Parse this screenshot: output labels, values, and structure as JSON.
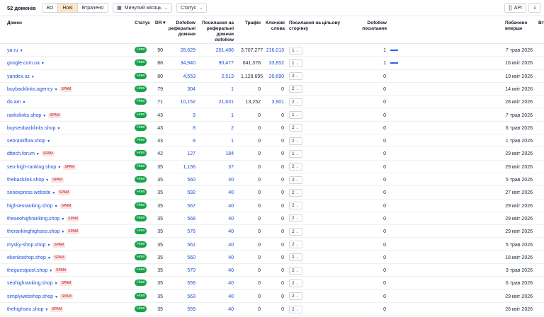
{
  "toolbar": {
    "count": "52 доменів",
    "tabs": [
      "Всі",
      "Нові",
      "Втрачено"
    ],
    "period": "Минулий місяць",
    "status_filter": "Статус",
    "api": "API"
  },
  "columns": {
    "domain": "Домен",
    "status": "Статус",
    "dr": "DR",
    "dofollow_ref": "Dofollow реферальні домени",
    "ref_domains": "Посилання на реферальні домени dofollow",
    "traffic": "Трафік",
    "keywords": "Ключові слова",
    "links_to_target": "Посилання на цільову сторінку",
    "dofollow_links": "Dofollow посилання",
    "first_seen": "Побачено вперше",
    "cut": "Вт"
  },
  "rows": [
    {
      "domain": "ya.ru",
      "spam": "",
      "status": "Нові",
      "dr": "90",
      "dofollow_ref": "28,629",
      "ref_domains": "201,486",
      "traffic": "3,707,277",
      "keywords": "216,013",
      "links": "1",
      "dofollow": "1",
      "bar": true,
      "first_seen": "7 трав 2026"
    },
    {
      "domain": "google.com.ua",
      "spam": "",
      "status": "Нові",
      "dr": "88",
      "dofollow_ref": "34,940",
      "ref_domains": "90,477",
      "traffic": "641,378",
      "keywords": "33,852",
      "links": "1",
      "dofollow": "1",
      "bar": true,
      "first_seen": "16 квіт 2026"
    },
    {
      "domain": "yandex.uz",
      "spam": "",
      "status": "Нові",
      "dr": "80",
      "dofollow_ref": "4,553",
      "ref_domains": "2,513",
      "traffic": "1,128,695",
      "keywords": "20,690",
      "links": "2",
      "dofollow": "0",
      "bar": false,
      "first_seen": "19 квіт 2026"
    },
    {
      "domain": "buybacklinks.agency",
      "spam": "SPAM",
      "status": "Нові",
      "dr": "79",
      "dofollow_ref": "304",
      "ref_domains": "1",
      "traffic": "0",
      "keywords": "0",
      "links": "2",
      "dofollow": "0",
      "bar": false,
      "first_seen": "14 квіт 2026"
    },
    {
      "domain": "do.am",
      "spam": "",
      "status": "Нові",
      "dr": "71",
      "dofollow_ref": "10,152",
      "ref_domains": "21,631",
      "traffic": "13,252",
      "keywords": "3,901",
      "links": "2",
      "dofollow": "0",
      "bar": false,
      "first_seen": "28 квіт 2026"
    },
    {
      "domain": "rankxlinks.shop",
      "spam": "SPAM",
      "status": "Нові",
      "dr": "43",
      "dofollow_ref": "9",
      "ref_domains": "1",
      "traffic": "0",
      "keywords": "0",
      "links": "1",
      "dofollow": "0",
      "bar": false,
      "first_seen": "7 трав 2026"
    },
    {
      "domain": "buyseobacklinks.shop",
      "spam": "",
      "status": "Нові",
      "dr": "43",
      "dofollow_ref": "8",
      "ref_domains": "2",
      "traffic": "0",
      "keywords": "0",
      "links": "2",
      "dofollow": "0",
      "bar": false,
      "first_seen": "6 трав 2026"
    },
    {
      "domain": "seorankflow.shop",
      "spam": "",
      "status": "Нові",
      "dr": "43",
      "dofollow_ref": "8",
      "ref_domains": "1",
      "traffic": "0",
      "keywords": "0",
      "links": "2",
      "dofollow": "0",
      "bar": false,
      "first_seen": "1 трав 2026"
    },
    {
      "domain": "dttech.forum",
      "spam": "SPAM",
      "status": "Нові",
      "dr": "42",
      "dofollow_ref": "127",
      "ref_domains": "184",
      "traffic": "0",
      "keywords": "0",
      "links": "1",
      "dofollow": "0",
      "bar": false,
      "first_seen": "29 квіт 2026"
    },
    {
      "domain": "seo-high-ranking.shop",
      "spam": "SPAM",
      "status": "Нові",
      "dr": "35",
      "dofollow_ref": "1,156",
      "ref_domains": "37",
      "traffic": "0",
      "keywords": "0",
      "links": "2",
      "dofollow": "0",
      "bar": false,
      "first_seen": "29 квіт 2026"
    },
    {
      "domain": "thebacklink.shop",
      "spam": "SPAM",
      "status": "Нові",
      "dr": "35",
      "dofollow_ref": "560",
      "ref_domains": "40",
      "traffic": "0",
      "keywords": "0",
      "links": "2",
      "dofollow": "0",
      "bar": false,
      "first_seen": "5 трав 2026"
    },
    {
      "domain": "seoexpress.website",
      "spam": "SPAM",
      "status": "Нові",
      "dr": "35",
      "dofollow_ref": "592",
      "ref_domains": "40",
      "traffic": "0",
      "keywords": "0",
      "links": "2",
      "dofollow": "0",
      "bar": false,
      "first_seen": "27 квіт 2026"
    },
    {
      "domain": "highseoranking.shop",
      "spam": "SPAM",
      "status": "Нові",
      "dr": "35",
      "dofollow_ref": "567",
      "ref_domains": "40",
      "traffic": "0",
      "keywords": "0",
      "links": "2",
      "dofollow": "0",
      "bar": false,
      "first_seen": "29 квіт 2026"
    },
    {
      "domain": "theseohighranking.shop",
      "spam": "SPAM",
      "status": "Нові",
      "dr": "35",
      "dofollow_ref": "568",
      "ref_domains": "40",
      "traffic": "0",
      "keywords": "0",
      "links": "2",
      "dofollow": "0",
      "bar": false,
      "first_seen": "29 квіт 2026"
    },
    {
      "domain": "therankinghighseo.shop",
      "spam": "SPAM",
      "status": "Нові",
      "dr": "35",
      "dofollow_ref": "576",
      "ref_domains": "40",
      "traffic": "0",
      "keywords": "0",
      "links": "2",
      "dofollow": "0",
      "bar": false,
      "first_seen": "29 квіт 2026"
    },
    {
      "domain": "mysky-shop.shop",
      "spam": "SPAM",
      "status": "Нові",
      "dr": "35",
      "dofollow_ref": "561",
      "ref_domains": "40",
      "traffic": "0",
      "keywords": "0",
      "links": "2",
      "dofollow": "0",
      "bar": false,
      "first_seen": "5 трав 2026"
    },
    {
      "domain": "ekenkoshop.shop",
      "spam": "SPAM",
      "status": "Нові",
      "dr": "35",
      "dofollow_ref": "560",
      "ref_domains": "40",
      "traffic": "0",
      "keywords": "0",
      "links": "2",
      "dofollow": "0",
      "bar": false,
      "first_seen": "18 квіт 2026"
    },
    {
      "domain": "theguestpost.shop",
      "spam": "SPAM",
      "status": "Нові",
      "dr": "35",
      "dofollow_ref": "570",
      "ref_domains": "40",
      "traffic": "0",
      "keywords": "0",
      "links": "2",
      "dofollow": "0",
      "bar": false,
      "first_seen": "3 трав 2026"
    },
    {
      "domain": "seohighranking.shop",
      "spam": "SPAM",
      "status": "Нові",
      "dr": "35",
      "dofollow_ref": "559",
      "ref_domains": "40",
      "traffic": "0",
      "keywords": "0",
      "links": "2",
      "dofollow": "0",
      "bar": false,
      "first_seen": "6 трав 2026"
    },
    {
      "domain": "simplywebshop.shop",
      "spam": "SPAM",
      "status": "Нові",
      "dr": "35",
      "dofollow_ref": "563",
      "ref_domains": "40",
      "traffic": "0",
      "keywords": "0",
      "links": "2",
      "dofollow": "0",
      "bar": false,
      "first_seen": "29 квіт 2026"
    },
    {
      "domain": "thehighseo.shop",
      "spam": "SPAM",
      "status": "Нові",
      "dr": "35",
      "dofollow_ref": "559",
      "ref_domains": "40",
      "traffic": "0",
      "keywords": "0",
      "links": "2",
      "dofollow": "0",
      "bar": false,
      "first_seen": "26 квіт 2026"
    }
  ]
}
